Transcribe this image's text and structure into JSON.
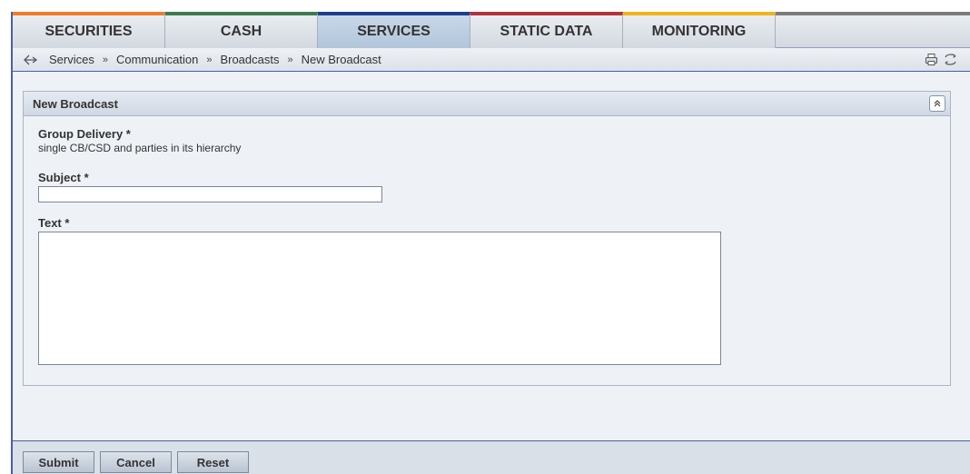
{
  "tabs": [
    {
      "label": "SECURITIES",
      "color": "#f07b2d",
      "active": false
    },
    {
      "label": "CASH",
      "color": "#3f7a4e",
      "active": false
    },
    {
      "label": "SERVICES",
      "color": "#1f3f8a",
      "active": true
    },
    {
      "label": "STATIC DATA",
      "color": "#b3343a",
      "active": false
    },
    {
      "label": "MONITORING",
      "color": "#f0b41e",
      "active": false
    }
  ],
  "breadcrumb": {
    "items": [
      "Services",
      "Communication",
      "Broadcasts",
      "New Broadcast"
    ],
    "separator": "»"
  },
  "panel": {
    "title": "New Broadcast",
    "group_delivery_label": "Group Delivery *",
    "group_delivery_value": "single CB/CSD and parties in its hierarchy",
    "subject_label": "Subject *",
    "subject_value": "",
    "text_label": "Text *",
    "text_value": ""
  },
  "footer": {
    "submit_label": "Submit",
    "cancel_label": "Cancel",
    "reset_label": "Reset"
  },
  "icons": [
    "back-arrow-icon",
    "print-icon",
    "refresh-icon",
    "collapse-up-icon"
  ]
}
